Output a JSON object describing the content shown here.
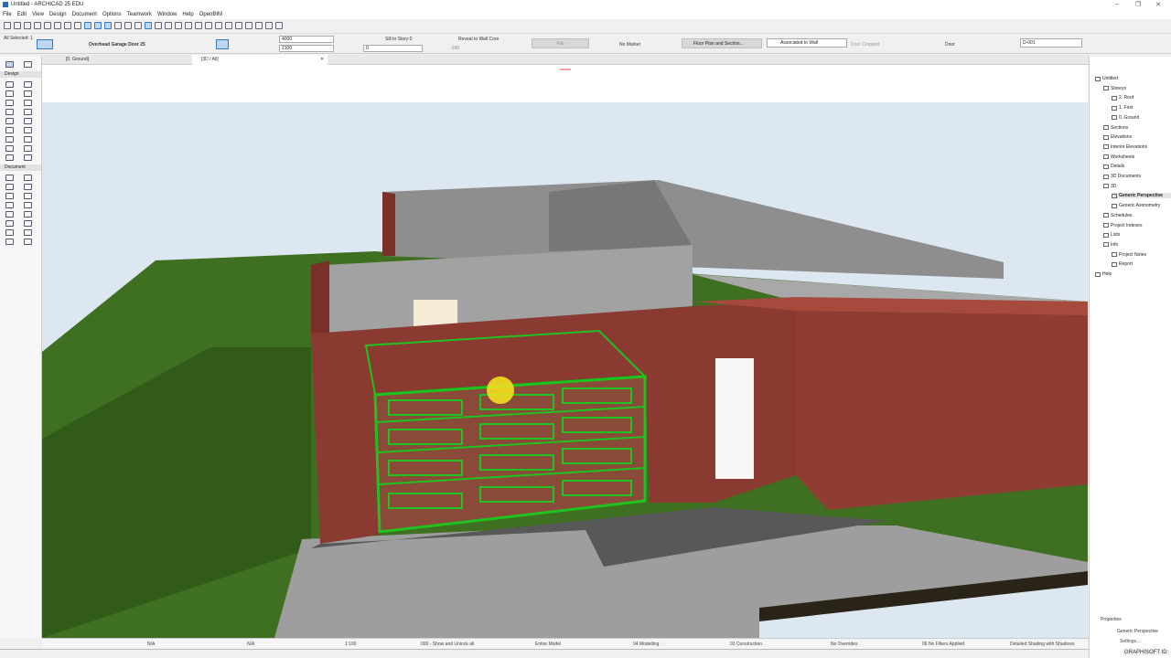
{
  "window": {
    "title": "Untitled - ARCHICAD 25 EDU",
    "min": "–",
    "restore": "❐",
    "close": "✕"
  },
  "menu": [
    "File",
    "Edit",
    "View",
    "Design",
    "Document",
    "Options",
    "Teamwork",
    "Window",
    "Help",
    "OpenBIM"
  ],
  "infobox": {
    "selection": "All Selected: 1",
    "element_name": "Overhead Garage Door 25",
    "width": "4000",
    "height": "2100",
    "sill_label": "Sill to Story 0",
    "sill_value": "0",
    "reveal_label": "Reveal to Wall Core",
    "reveal_value": "-160",
    "flip": "Flip",
    "marker": "No Marker",
    "display": "Floor Plan and Section...",
    "association": "Associated to Wall",
    "cropped": "Door Cropped",
    "type": "Door",
    "id": "D-001"
  },
  "tabs": {
    "floor": "[0. Ground]",
    "view3d": "[3D / All]",
    "close": "✕"
  },
  "toolbox": {
    "design": "Design",
    "document": "Document"
  },
  "navigator": {
    "items": [
      {
        "label": "Untitled",
        "level": 0,
        "open": true
      },
      {
        "label": "Storeys",
        "level": 1,
        "open": true
      },
      {
        "label": "2. Roof",
        "level": 2
      },
      {
        "label": "1. First",
        "level": 2
      },
      {
        "label": "0. Ground",
        "level": 2
      },
      {
        "label": "Sections",
        "level": 1,
        "closed": true
      },
      {
        "label": "Elevations",
        "level": 1,
        "closed": true
      },
      {
        "label": "Interior Elevations",
        "level": 1
      },
      {
        "label": "Worksheets",
        "level": 1,
        "closed": true
      },
      {
        "label": "Details",
        "level": 1
      },
      {
        "label": "3D Documents",
        "level": 1,
        "closed": true
      },
      {
        "label": "3D",
        "level": 1,
        "open": true
      },
      {
        "label": "Generic Perspective",
        "level": 2,
        "selected": true
      },
      {
        "label": "Generic Axonometry",
        "level": 2
      },
      {
        "label": "Schedules",
        "level": 1,
        "closed": true
      },
      {
        "label": "Project Indexes",
        "level": 1,
        "closed": true
      },
      {
        "label": "Lists",
        "level": 1,
        "closed": true
      },
      {
        "label": "Info",
        "level": 1,
        "open": true
      },
      {
        "label": "Project Notes",
        "level": 2
      },
      {
        "label": "Report",
        "level": 2
      },
      {
        "label": "Help",
        "level": 0,
        "closed": true
      }
    ],
    "properties": "Properties",
    "prop_value": "Generic Perspective",
    "settings": "Settings...",
    "graphisoft": "GRAPHISOFT ID"
  },
  "status": {
    "na1": "N/A",
    "na2": "N/A",
    "scale": "1:100",
    "layers": "000 - Show and Unlock all",
    "model": "Entire Model",
    "pen": "04 Modelling",
    "mvo": "03 Construction",
    "overrides": "No Overrides",
    "filters": "06 No Filters Applied",
    "shading": "Detailed Shading with Shadows"
  },
  "colors": {
    "accent": "#3a78c2",
    "selection": "#1fc21f",
    "brick": "#8a3a30",
    "grass": "#3f6f20"
  }
}
